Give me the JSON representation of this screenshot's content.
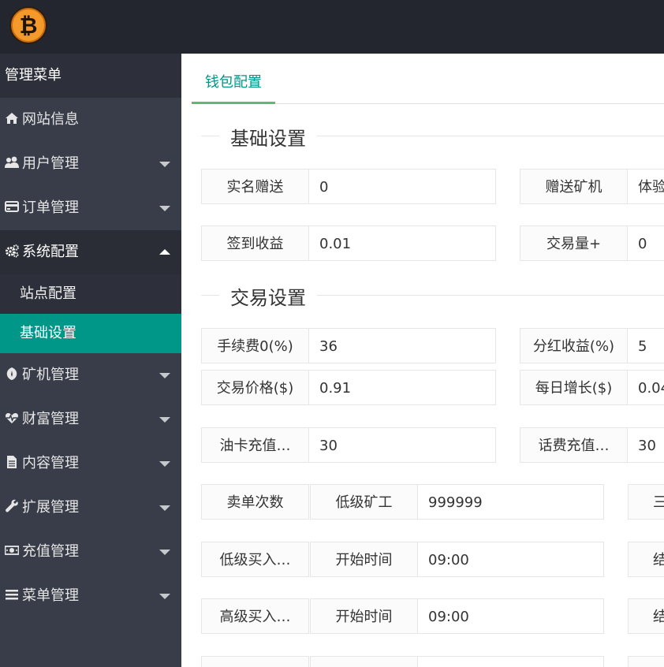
{
  "brand": {
    "logo_icon": "bitcoin-logo-icon",
    "logo_color": "#f7931a"
  },
  "sidebar": {
    "header": "管理菜单",
    "items": [
      {
        "label": "网站信息",
        "icon": "home-icon"
      },
      {
        "label": "用户管理",
        "icon": "users-icon"
      },
      {
        "label": "订单管理",
        "icon": "credit-card-icon"
      },
      {
        "label": "系统配置",
        "icon": "gears-icon"
      },
      {
        "label": "矿机管理",
        "icon": "rebel-icon"
      },
      {
        "label": "财富管理",
        "icon": "heartbeat-icon"
      },
      {
        "label": "内容管理",
        "icon": "file-icon"
      },
      {
        "label": "扩展管理",
        "icon": "wrench-icon"
      },
      {
        "label": "充值管理",
        "icon": "money-icon"
      },
      {
        "label": "菜单管理",
        "icon": "bars-icon"
      }
    ],
    "subitems": [
      {
        "label": "站点配置"
      },
      {
        "label": "基础设置"
      }
    ],
    "accent": "#009688"
  },
  "tabs": {
    "active": "钱包配置"
  },
  "sections": {
    "basic": "基础设置",
    "trade": "交易设置"
  },
  "fields": {
    "real_name_gift": {
      "label": "实名赠送",
      "value": "0"
    },
    "gift_miner": {
      "label": "赠送矿机",
      "value": "体验"
    },
    "checkin_income": {
      "label": "签到收益",
      "value": "0.01"
    },
    "trade_volume": {
      "label": "交易量+",
      "value": "0"
    },
    "fee": {
      "label": "手续费0(%)",
      "value": "36"
    },
    "dividend": {
      "label": "分红收益(%)",
      "value": "5"
    },
    "trade_price": {
      "label": "交易价格($)",
      "value": "0.91"
    },
    "daily_growth": {
      "label": "每日增长($)",
      "value": "0.04"
    },
    "oil_card": {
      "label": "油卡充值…",
      "value": "30"
    },
    "phone_recharge": {
      "label": "话费充值…",
      "value": "30"
    },
    "sell_count": {
      "label": "卖单次数",
      "sublabel": "低级矿工",
      "value": "999999",
      "right_partial": "三"
    },
    "low_buy": {
      "label": "低级买入…",
      "sublabel": "开始时间",
      "value": "09:00",
      "right_partial": "结"
    },
    "high_buy": {
      "label": "高级买入…",
      "sublabel": "开始时间",
      "value": "09:00",
      "right_partial": "结"
    }
  }
}
